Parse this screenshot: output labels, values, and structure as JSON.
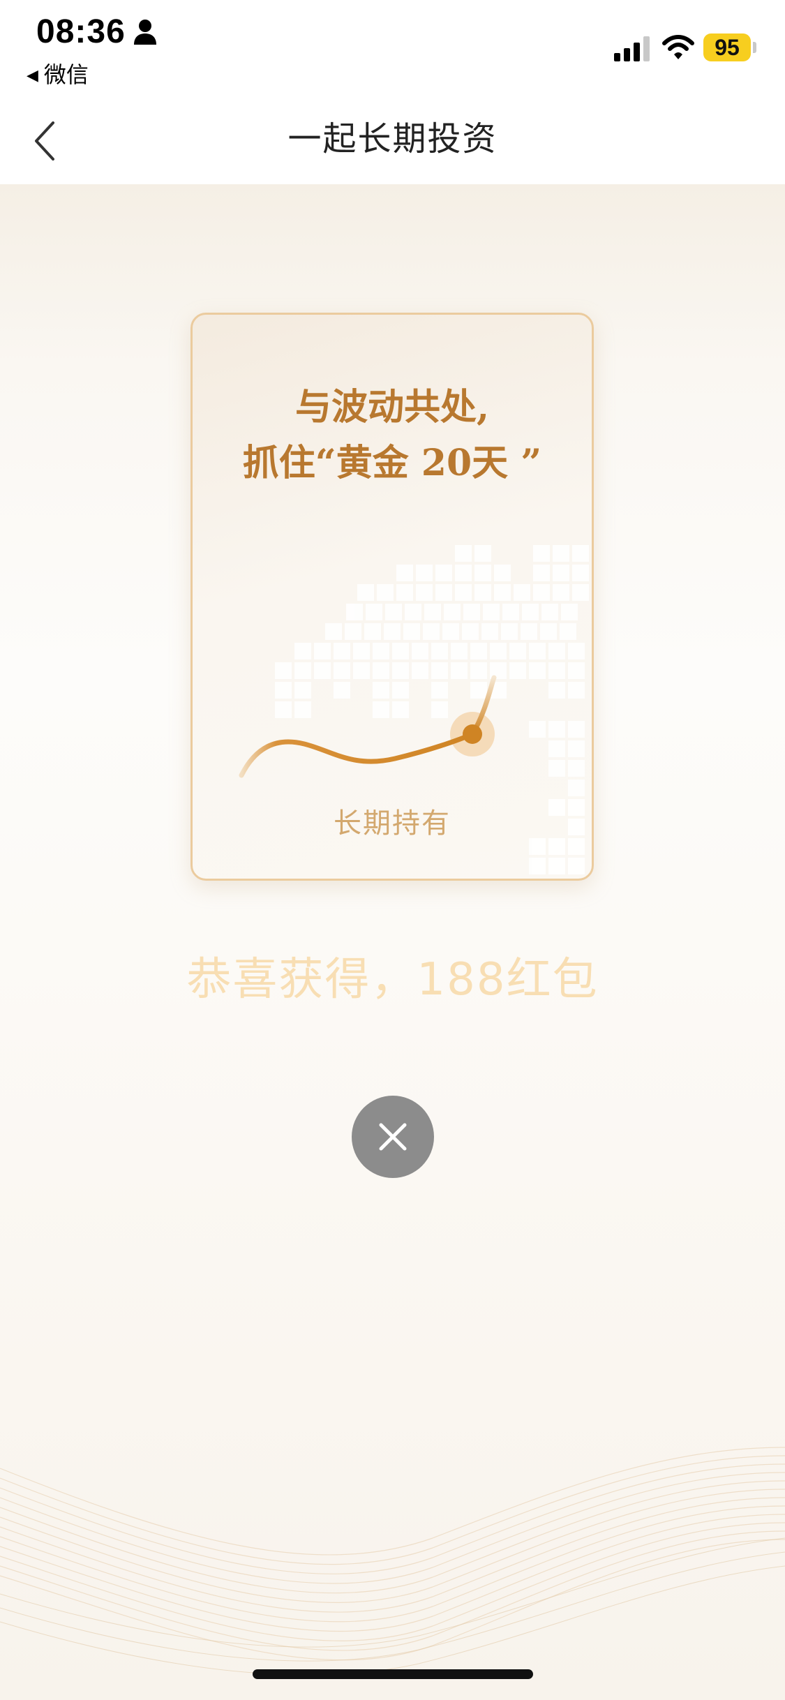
{
  "status_bar": {
    "time": "08:36",
    "back_app_label": "微信",
    "battery_level": "95",
    "icons": [
      "person-icon",
      "signal-icon",
      "wifi-icon",
      "battery-icon"
    ]
  },
  "nav": {
    "title": "一起长期投资",
    "back_icon": "chevron-left-icon"
  },
  "card": {
    "title_line1": "与波动共处,",
    "title_line2": "抓住“黄金 20天 ”",
    "caption": "长期持有"
  },
  "reward": {
    "text": "恭喜获得，188红包"
  },
  "close_button": {
    "icon": "close-icon"
  },
  "colors": {
    "accent": "#b8782f",
    "card_border": "#ebcb9e",
    "congrats_text": "#f8deb3",
    "close_button_bg": "#8c8c8c",
    "battery": "#f7ce1f"
  }
}
